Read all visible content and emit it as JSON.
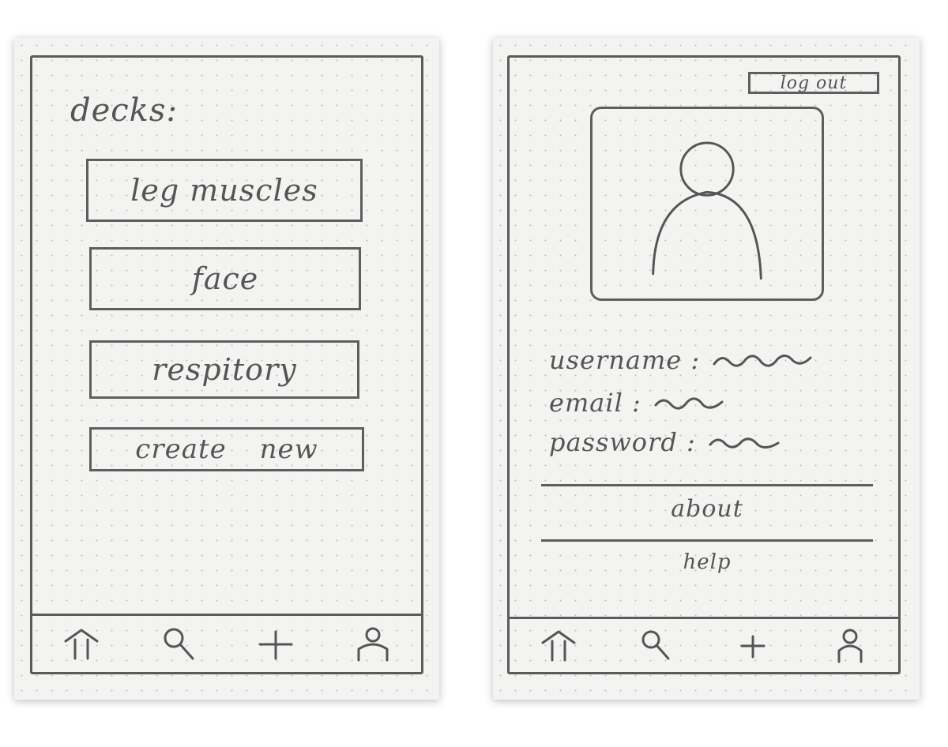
{
  "left_screen": {
    "title": "decks:",
    "decks": [
      {
        "label": "leg muscles"
      },
      {
        "label": "face"
      },
      {
        "label": "respitory"
      }
    ],
    "create_label": "create new"
  },
  "right_screen": {
    "logout_label": "log out",
    "fields": [
      {
        "label": "username :"
      },
      {
        "label": "email :"
      },
      {
        "label": "password :"
      }
    ],
    "menu": [
      {
        "label": "about"
      },
      {
        "label": "help"
      }
    ]
  },
  "nav_icons": [
    "home-icon",
    "search-icon",
    "plus-icon",
    "profile-icon"
  ],
  "colors": {
    "paper": "#f3f3f2",
    "pencil": "#555555"
  }
}
